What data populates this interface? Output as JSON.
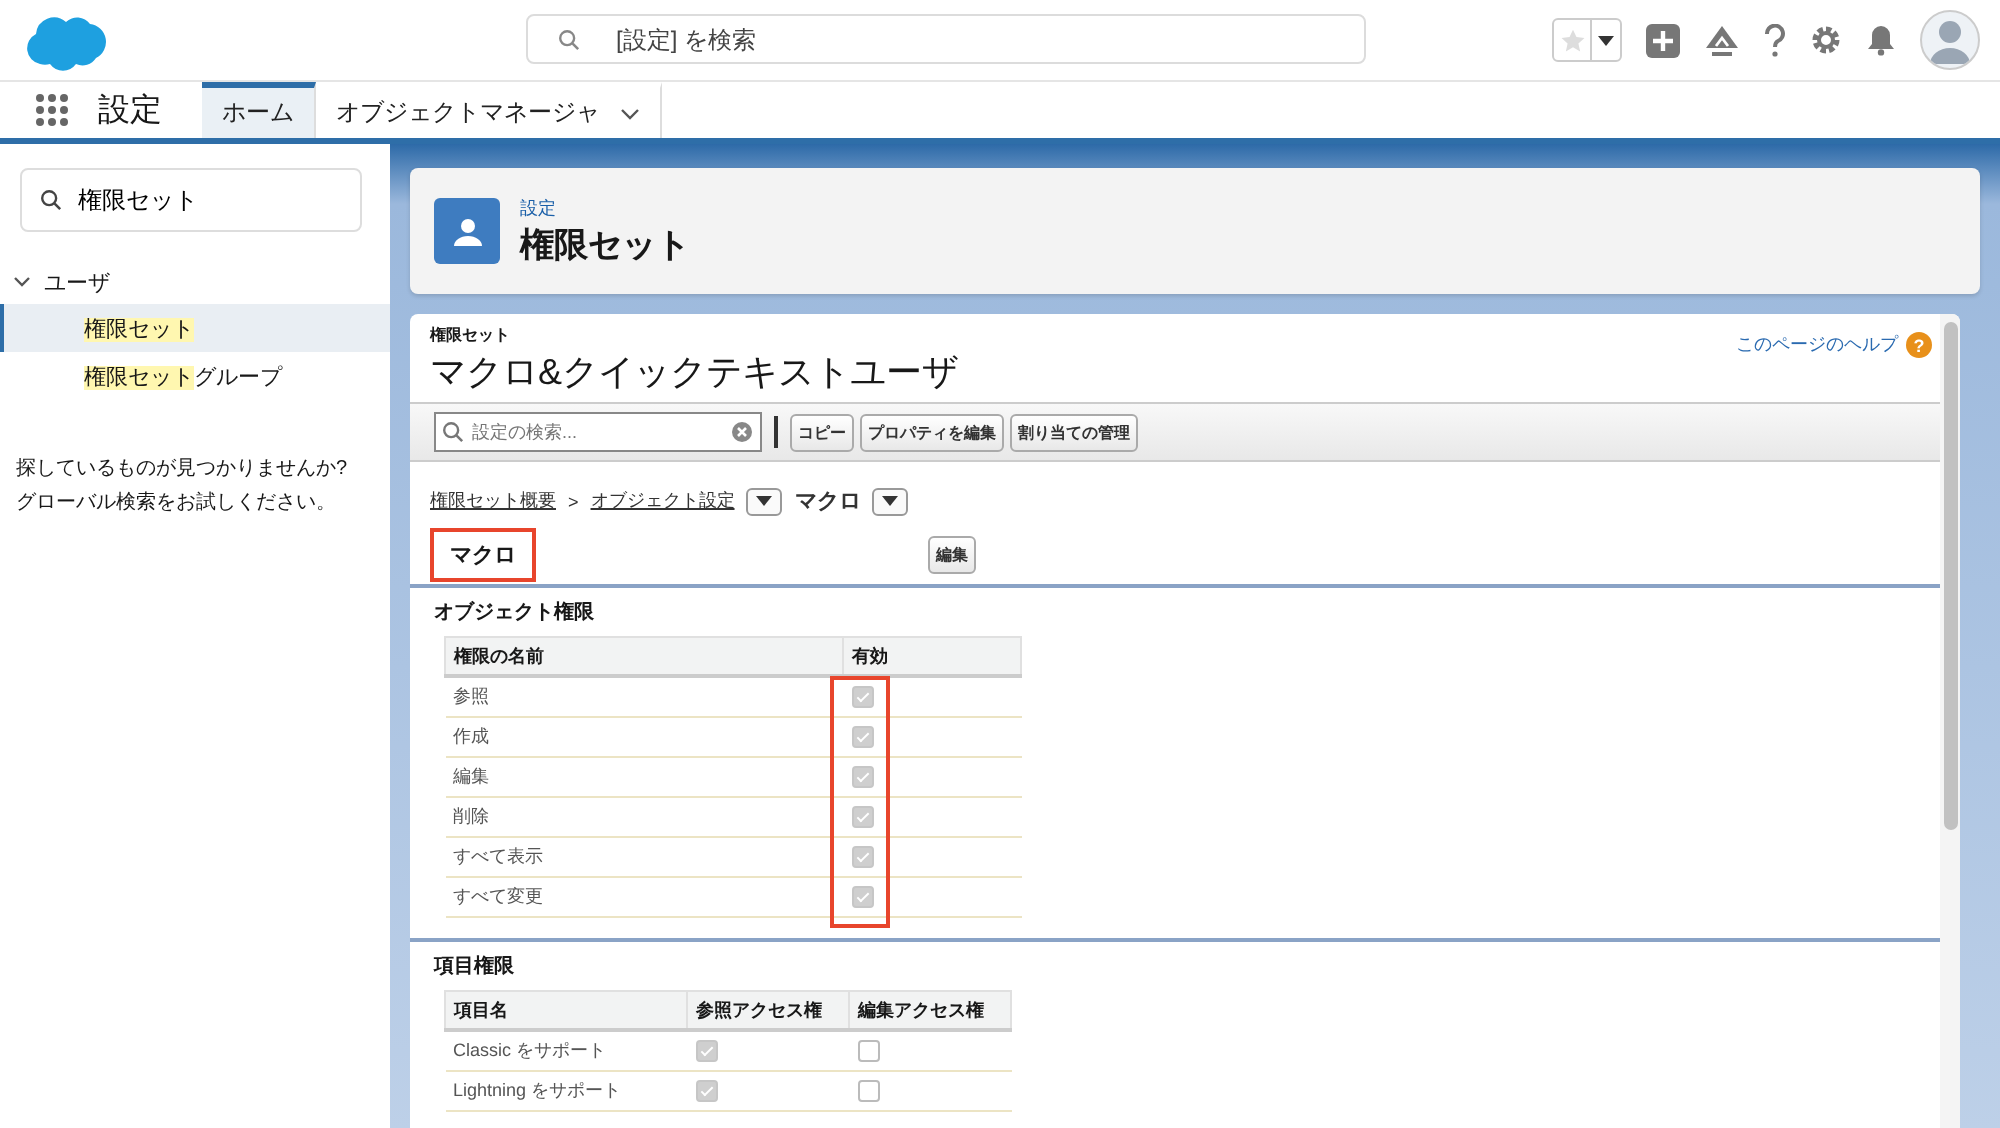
{
  "header": {
    "search_placeholder": "[設定] を検索"
  },
  "nav": {
    "app_name": "設定",
    "tabs": [
      {
        "label": "ホーム",
        "selected": true,
        "dropdown": false
      },
      {
        "label": "オブジェクトマネージャ",
        "selected": false,
        "dropdown": true
      }
    ]
  },
  "sidebar": {
    "search_value": "権限セット",
    "tree": [
      {
        "label": "ユーザ",
        "expanded": true,
        "children": [
          {
            "match": "権限セット",
            "selected": true
          },
          {
            "match": "権限セット",
            "rest": "グループ",
            "selected": false
          }
        ]
      }
    ],
    "empty_hint": [
      "探しているものが見つかりませんか?",
      "グローバル検索をお試しください。"
    ]
  },
  "page_header": {
    "eyebrow": "設定",
    "title": "権限セット"
  },
  "detail": {
    "eyebrow": "権限セット",
    "title": "マクロ&クイックテキストユーザ",
    "help_link": "このページのヘルプ",
    "help_icon": "?",
    "toolbar": {
      "search_placeholder": "設定の検索...",
      "buttons": [
        "コピー",
        "プロパティを編集",
        "割り当ての管理"
      ]
    },
    "breadcrumb": {
      "links": [
        "権限セット概要",
        "オブジェクト設定"
      ],
      "separator": ">",
      "current": "マクロ"
    },
    "section": {
      "title": "マクロ",
      "highlighted": true,
      "edit_button": "編集"
    },
    "object_permissions": {
      "title": "オブジェクト権限",
      "columns": [
        "権限の名前",
        "有効"
      ],
      "column_highlighted": true,
      "rows": [
        {
          "name": "参照",
          "checked": true
        },
        {
          "name": "作成",
          "checked": true
        },
        {
          "name": "編集",
          "checked": true
        },
        {
          "name": "削除",
          "checked": true
        },
        {
          "name": "すべて表示",
          "checked": true
        },
        {
          "name": "すべて変更",
          "checked": true
        }
      ]
    },
    "field_permissions": {
      "title": "項目権限",
      "columns": [
        "項目名",
        "参照アクセス権",
        "編集アクセス権"
      ],
      "rows": [
        {
          "name": "Classic をサポート",
          "read": true,
          "edit": false
        },
        {
          "name": "Lightning をサポート",
          "read": true,
          "edit": false
        }
      ]
    }
  }
}
